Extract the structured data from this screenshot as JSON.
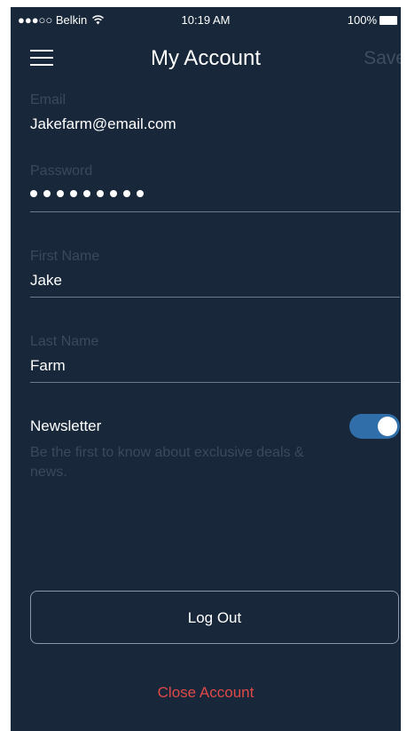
{
  "status_bar": {
    "carrier": "●●●○○ Belkin",
    "time": "10:19 AM",
    "battery": "100%"
  },
  "header": {
    "title": "My Account",
    "save_label": "Save",
    "menu_icon": "hamburger-menu-icon"
  },
  "form": {
    "email": {
      "label": "Email",
      "value": "Jakefarm@email.com"
    },
    "password": {
      "label": "Password",
      "masked_length": 9
    },
    "first_name": {
      "label": "First Name",
      "value": "Jake"
    },
    "last_name": {
      "label": "Last Name",
      "value": "Farm"
    }
  },
  "newsletter": {
    "label": "Newsletter",
    "description": "Be the first to know about exclusive deals & news.",
    "enabled": true
  },
  "actions": {
    "logout_label": "Log Out",
    "close_account_label": "Close Account"
  },
  "colors": {
    "background": "#18283a",
    "toggle_on": "#2f6ea9",
    "danger": "#e04848"
  }
}
